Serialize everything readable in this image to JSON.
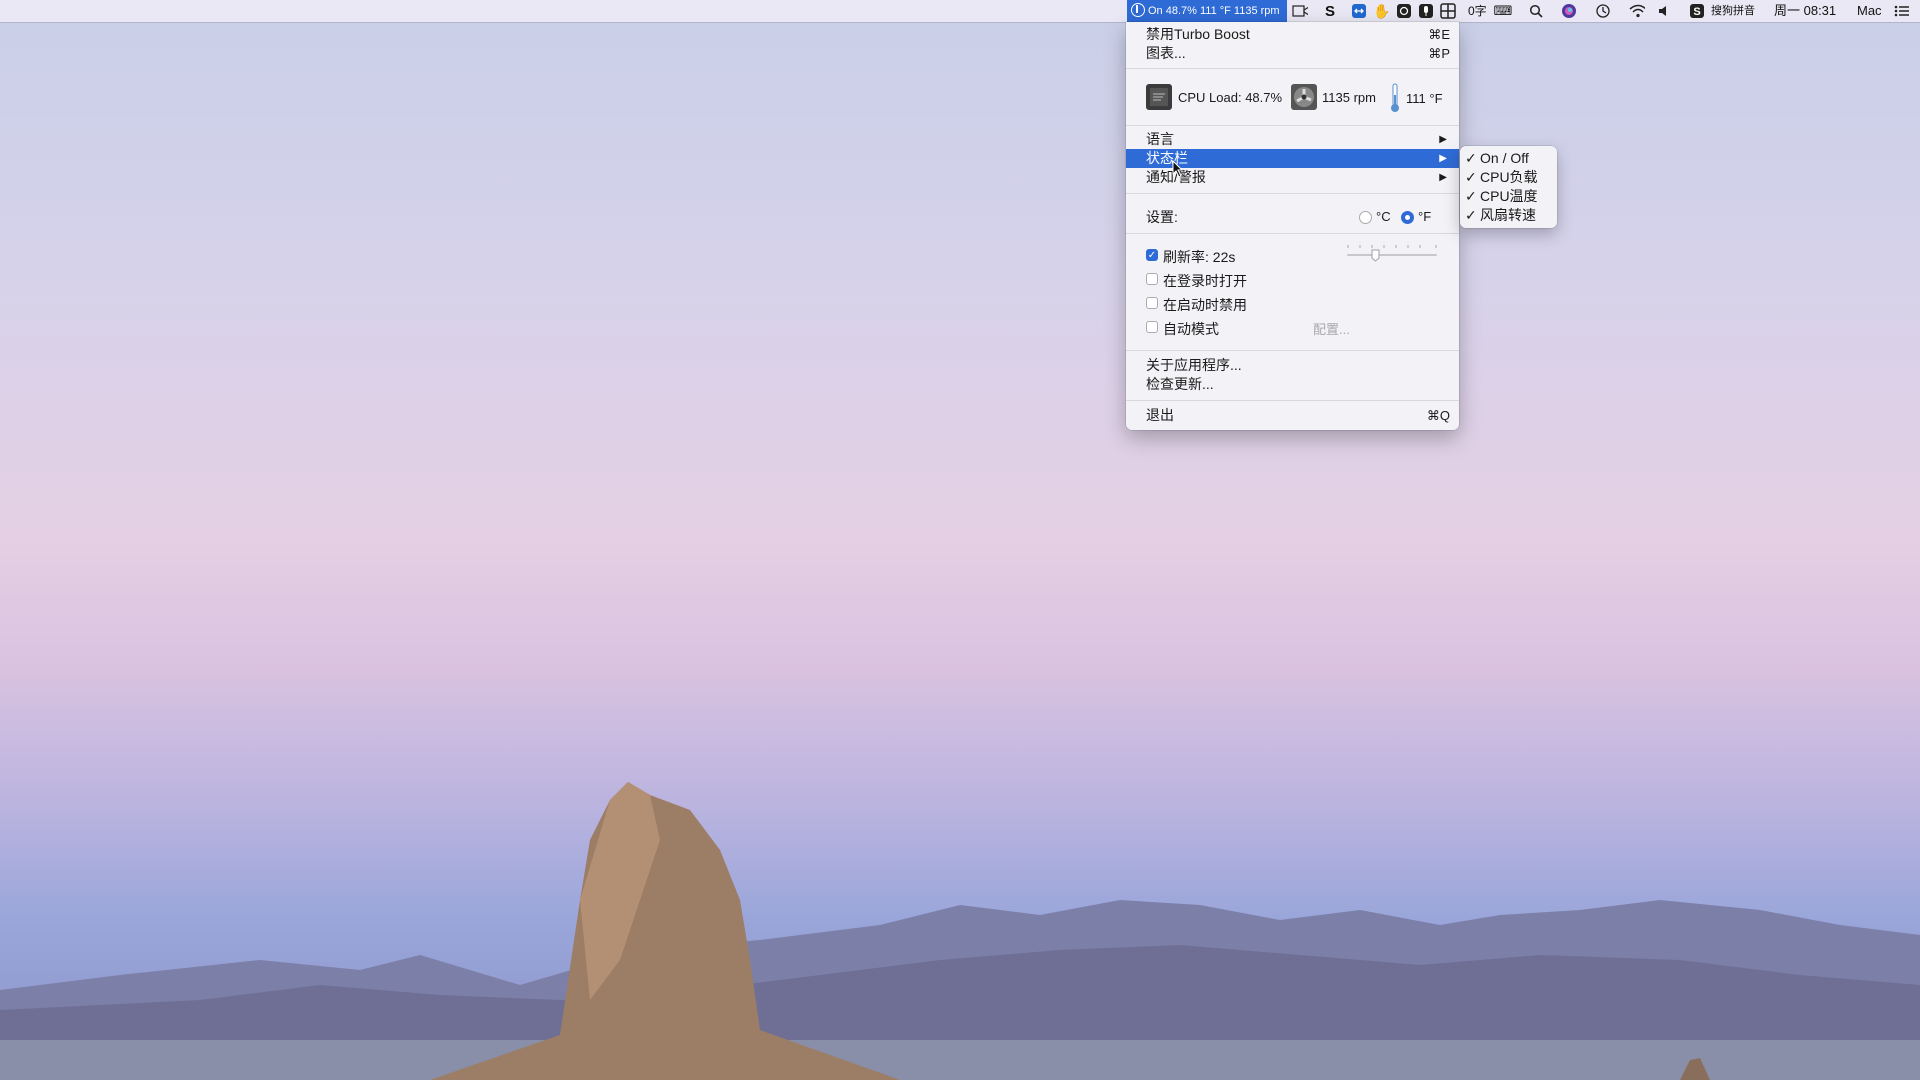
{
  "menubar": {
    "turbo_status": "On 48.7% 111 °F 1135 rpm",
    "input_count": "0字",
    "input_method": "搜狗拼音",
    "clock": "周一 08:31",
    "user": "Mac",
    "icons": [
      "facetime-camera-icon",
      "sogou-s-icon",
      "teamviewer-icon",
      "hand-icon",
      "screenshot-icon",
      "mic-icon",
      "grid-icon",
      "keyboard-icon",
      "search-icon",
      "siri-icon",
      "time-machine-icon",
      "wifi-icon",
      "volume-icon",
      "sogou-icon",
      "notification-center-icon"
    ]
  },
  "menu": {
    "disable_turbo": {
      "label": "禁用Turbo Boost",
      "shortcut": "⌘E"
    },
    "charts": {
      "label": "图表...",
      "shortcut": "⌘P"
    },
    "stats": {
      "cpu_load": "CPU Load: 48.7%",
      "fan": "1135 rpm",
      "temp": "111 °F"
    },
    "language": "语言",
    "status_bar": "状态栏",
    "notifications": "通知/警报",
    "settings_label": "设置:",
    "unit_c": "°C",
    "unit_f": "°F",
    "selected_unit": "F",
    "refresh": {
      "label": "刷新率: 22s",
      "checked": true,
      "slider_value": 22
    },
    "open_at_login": {
      "label": "在登录时打开",
      "checked": false
    },
    "disable_at_startup": {
      "label": "在启动时禁用",
      "checked": false
    },
    "auto_mode": {
      "label": "自动模式",
      "checked": false,
      "config": "配置..."
    },
    "about": "关于应用程序...",
    "check_updates": "检查更新...",
    "quit": {
      "label": "退出",
      "shortcut": "⌘Q"
    }
  },
  "submenu": {
    "items": [
      {
        "label": "On / Off",
        "checked": true
      },
      {
        "label": "CPU负载",
        "checked": true
      },
      {
        "label": "CPU温度",
        "checked": true
      },
      {
        "label": "风扇转速",
        "checked": true
      }
    ]
  },
  "colors": {
    "accent": "#2f6bd6",
    "menu_bg": "#f4f3f6"
  }
}
